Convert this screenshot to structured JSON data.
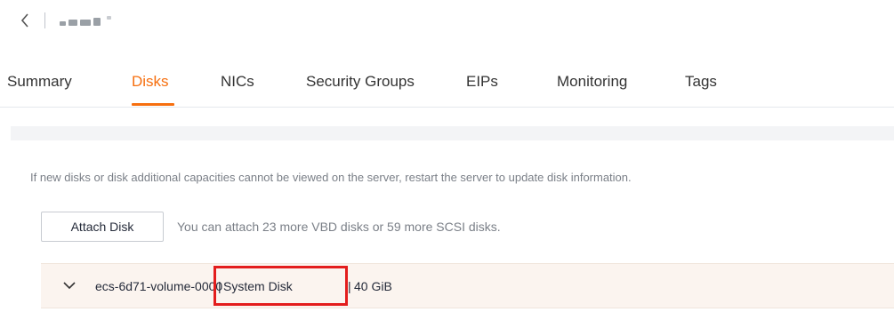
{
  "header": {
    "back_icon": "chevron-left-icon",
    "title_redacted": true
  },
  "tabs": [
    {
      "label": "Summary",
      "active": false
    },
    {
      "label": "Disks",
      "active": true
    },
    {
      "label": "NICs",
      "active": false
    },
    {
      "label": "Security Groups",
      "active": false
    },
    {
      "label": "EIPs",
      "active": false
    },
    {
      "label": "Monitoring",
      "active": false
    },
    {
      "label": "Tags",
      "active": false
    }
  ],
  "disks_panel": {
    "notice": "If new disks or disk additional capacities cannot be viewed on the server, restart the server to update disk information.",
    "attach_button_label": "Attach Disk",
    "attach_hint": "You can attach 23 more VBD disks or 59 more SCSI disks.",
    "disk_row": {
      "expand_icon": "chevron-down-icon",
      "name": "ecs-6d71-volume-0000",
      "separator": "|",
      "type": "System Disk",
      "size": "40 GiB"
    }
  },
  "colors": {
    "accent": "#f66f0f",
    "highlight": "#e31d1d",
    "row_background": "#fbf4ef"
  }
}
